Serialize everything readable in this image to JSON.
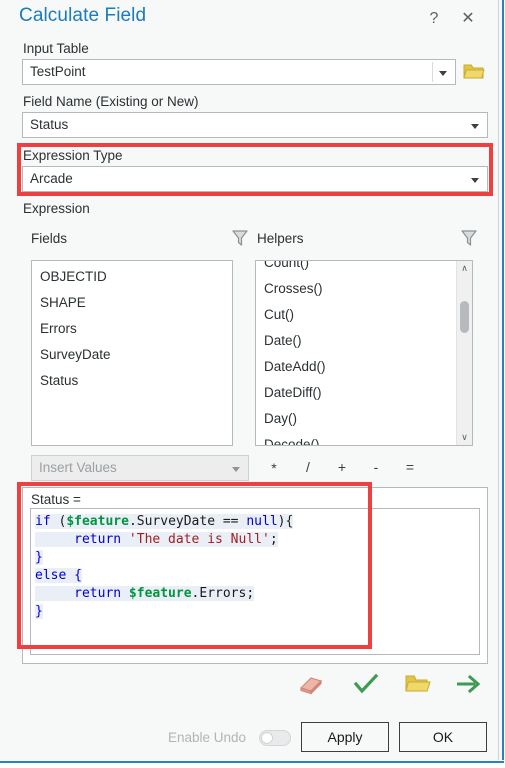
{
  "window": {
    "title": "Calculate Field",
    "help_icon": "?",
    "close_icon": "✕"
  },
  "input_table": {
    "label": "Input Table",
    "value": "TestPoint",
    "browse_icon": "folder-open-icon"
  },
  "field_name": {
    "label": "Field Name (Existing or New)",
    "value": "Status"
  },
  "expression_type": {
    "label": "Expression Type",
    "value": "Arcade",
    "highlighted": true,
    "highlight_color": "#f03f3f"
  },
  "expression": {
    "section_label": "Expression",
    "fields": {
      "label": "Fields",
      "filter_icon": "funnel-filter-icon",
      "items": [
        "OBJECTID",
        "SHAPE",
        "Errors",
        "SurveyDate",
        "Status"
      ]
    },
    "helpers": {
      "label": "Helpers",
      "filter_icon": "funnel-filter-icon",
      "items": [
        "Count()",
        "Crosses()",
        "Cut()",
        "Date()",
        "DateAdd()",
        "DateDiff()",
        "Day()",
        "Decode()"
      ],
      "scroll_up_icon": "∧",
      "scroll_down_icon": "∨"
    },
    "insert_values": {
      "placeholder": "Insert Values"
    },
    "operators": [
      "*",
      "/",
      "+",
      "-",
      "="
    ],
    "result_prefix": "Status =",
    "code_lines": [
      [
        {
          "t": "if ",
          "c": "kw"
        },
        {
          "t": "(",
          "c": "punct"
        },
        {
          "t": "$feature",
          "c": "var"
        },
        {
          "t": ".SurveyDate ",
          "c": "plain"
        },
        {
          "t": "== ",
          "c": "plain"
        },
        {
          "t": "null",
          "c": "kw"
        },
        {
          "t": "){",
          "c": "punct"
        }
      ],
      [
        {
          "t": "     return ",
          "c": "kw"
        },
        {
          "t": "'The date is Null'",
          "c": "str"
        },
        {
          "t": ";",
          "c": "punct"
        }
      ],
      [
        {
          "t": "}",
          "c": "kw"
        }
      ],
      [
        {
          "t": "else {",
          "c": "kw"
        }
      ],
      [
        {
          "t": "     return ",
          "c": "kw"
        },
        {
          "t": "$feature",
          "c": "var"
        },
        {
          "t": ".Errors",
          "c": "plain"
        },
        {
          "t": ";",
          "c": "punct"
        }
      ],
      [
        {
          "t": "}",
          "c": "kw"
        }
      ]
    ],
    "highlighted": true
  },
  "toolbar_icons": [
    {
      "name": "book-help-icon",
      "color": "#e8998d"
    },
    {
      "name": "check-validate-icon",
      "color": "#3f9a52"
    },
    {
      "name": "folder-open-icon",
      "color": "#e3c44a"
    },
    {
      "name": "arrow-right-icon",
      "color": "#3f9a52"
    }
  ],
  "footer": {
    "enable_undo_label": "Enable Undo",
    "enable_undo_state": "off",
    "apply_label": "Apply",
    "ok_label": "OK"
  }
}
